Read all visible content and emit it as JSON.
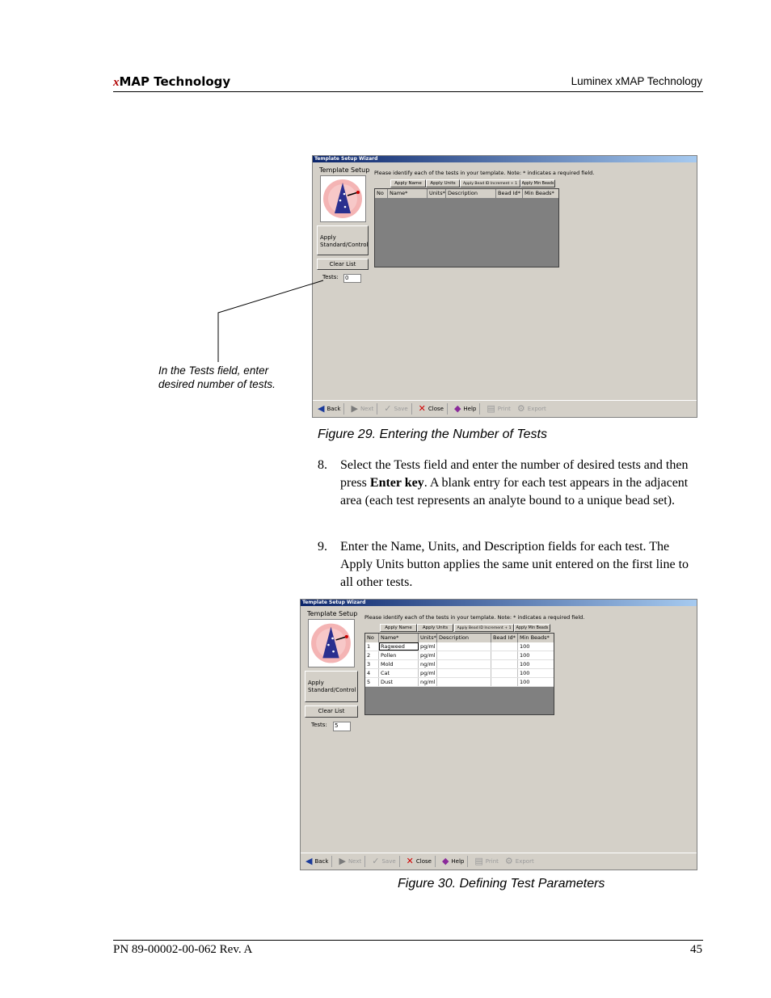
{
  "header": {
    "brand_x": "x",
    "brand_rest": "MAP Technology",
    "right": "Luminex xMAP Technology"
  },
  "callout": {
    "line1": "In the Tests field, enter",
    "line2": "desired number of tests."
  },
  "captions": {
    "fig29": "Figure 29.  Entering the Number of Tests",
    "fig30": "Figure 30.  Defining Test Parameters"
  },
  "steps": [
    {
      "num": "8.",
      "pre": "Select the Tests field and enter the number of desired tests and then press ",
      "bold": "Enter key",
      "post": ". A blank entry for each test appears in the adjacent area (each test represents an analyte bound to a unique bead set)."
    },
    {
      "num": "9.",
      "text": "Enter the Name, Units, and Description fields for each test. The Apply Units button applies the same unit entered on the first line to all other tests."
    }
  ],
  "wizard": {
    "title": "Template Setup Wizard",
    "heading": "Template Setup",
    "instruction": "Please identify each of the tests in your template.  Note: * indicates a required field.",
    "apply_buttons": [
      "Apply Name",
      "Apply Units",
      "Apply Bead ID Increment + 1",
      "Apply Min Beads"
    ],
    "columns": [
      "No",
      "Name*",
      "Units*",
      "Description",
      "Bead Id*",
      "Min Beads*"
    ],
    "apply_std_1": "Apply",
    "apply_std_2": "Standard/Control",
    "clear_list": "Clear List",
    "tests_label": "Tests:",
    "toolbar": [
      "Back",
      "Next",
      "Save",
      "Close",
      "Help",
      "Print",
      "Export"
    ]
  },
  "window1": {
    "tests_value": "0"
  },
  "window2": {
    "tests_value": "5",
    "rows": [
      {
        "no": "1",
        "name": "Ragweed",
        "units": "pg/ml",
        "desc": "",
        "bead": "",
        "min": "100"
      },
      {
        "no": "2",
        "name": "Pollen",
        "units": "pg/ml",
        "desc": "",
        "bead": "",
        "min": "100"
      },
      {
        "no": "3",
        "name": "Mold",
        "units": "ng/ml",
        "desc": "",
        "bead": "",
        "min": "100"
      },
      {
        "no": "4",
        "name": "Cat",
        "units": "pg/ml",
        "desc": "",
        "bead": "",
        "min": "100"
      },
      {
        "no": "5",
        "name": "Dust",
        "units": "ng/ml",
        "desc": "",
        "bead": "",
        "min": "100"
      }
    ]
  },
  "footer": {
    "left": "PN 89-00002-00-062 Rev. A",
    "right": "45"
  }
}
